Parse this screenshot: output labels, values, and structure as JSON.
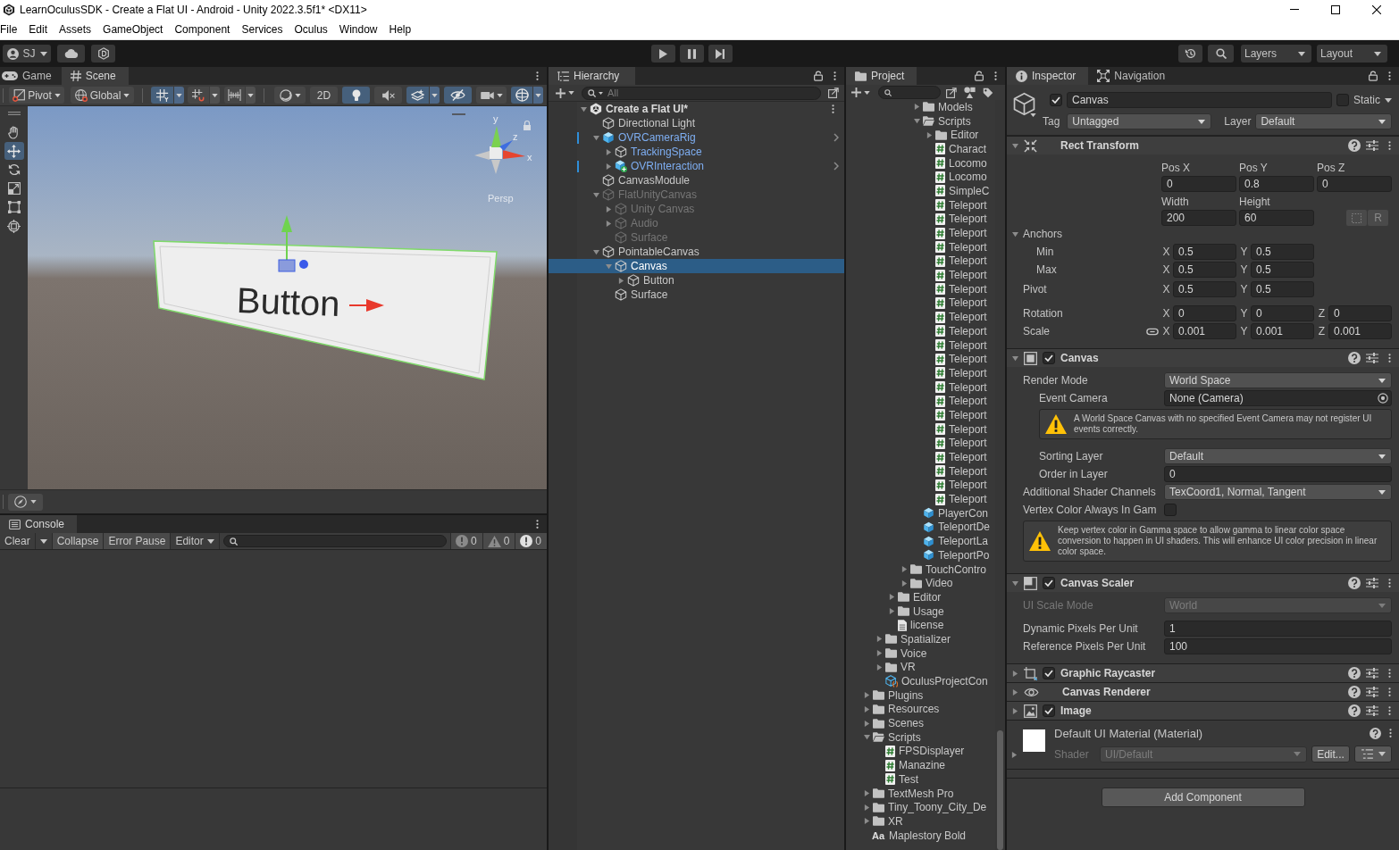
{
  "window": {
    "title": "LearnOculusSDK - Create a Flat UI - Android - Unity 2022.3.5f1* <DX11>"
  },
  "menu": [
    "File",
    "Edit",
    "Assets",
    "GameObject",
    "Component",
    "Services",
    "Oculus",
    "Window",
    "Help"
  ],
  "toolbar": {
    "account": "SJ",
    "layers": "Layers",
    "layout": "Layout"
  },
  "scene": {
    "tabs": [
      {
        "label": "Game",
        "kind": "game",
        "selected": false
      },
      {
        "label": "Scene",
        "kind": "scene",
        "selected": true
      }
    ],
    "toolbar": [
      {
        "kind": "pivot",
        "label": "Pivot",
        "on": false
      },
      {
        "kind": "global",
        "label": "Global",
        "on": false
      },
      {
        "kind": "grid",
        "on": true
      },
      {
        "kind": "snap",
        "on": false
      },
      {
        "kind": "increment",
        "on": false
      },
      {
        "kind": "shading",
        "on": false
      },
      {
        "kind": "flat",
        "label": "2D",
        "on": false
      },
      {
        "kind": "light",
        "on": true
      },
      {
        "kind": "audio",
        "on": false
      },
      {
        "kind": "fx",
        "on": true
      },
      {
        "kind": "visibility",
        "on": true
      },
      {
        "kind": "camera",
        "on": false
      },
      {
        "kind": "gizmos",
        "on": true
      }
    ],
    "tools": [
      {
        "kind": "view",
        "selected": false
      },
      {
        "kind": "move",
        "selected": true
      },
      {
        "kind": "rotate",
        "selected": false
      },
      {
        "kind": "scale",
        "selected": false
      },
      {
        "kind": "rect",
        "selected": false
      },
      {
        "kind": "transform",
        "selected": false
      }
    ],
    "viewport": {
      "canvas_text": "Button",
      "axis_labels": [
        "y",
        "x",
        "z"
      ],
      "projection": "Persp"
    }
  },
  "console": {
    "tab": "Console",
    "clear": "Clear",
    "collapse": {
      "label": "Collapse",
      "on": false
    },
    "error_pause": {
      "label": "Error Pause",
      "on": false
    },
    "target": "Editor",
    "counts": [
      {
        "kind": "log",
        "count": "0"
      },
      {
        "kind": "warning",
        "count": "0"
      },
      {
        "kind": "error",
        "count": "0"
      }
    ]
  },
  "hierarchy": {
    "tab": "Hierarchy",
    "search": {
      "placeholder": "All"
    },
    "tree": [
      {
        "label": "Create a Flat UI*",
        "kind": "scene",
        "expanded": true,
        "selected": false,
        "inactive": false,
        "children": [
          {
            "label": "Directional Light",
            "kind": "object",
            "selected": false,
            "inactive": false
          },
          {
            "label": "OVRCameraRig",
            "kind": "prefab-root",
            "expanded": true,
            "selected": false,
            "inactive": false,
            "children": [
              {
                "label": "TrackingSpace",
                "kind": "prefab-child",
                "expanded": false,
                "selected": false,
                "inactive": false
              },
              {
                "label": "OVRInteraction",
                "kind": "prefab-root-added",
                "expanded": false,
                "selected": false,
                "inactive": false
              }
            ]
          },
          {
            "label": "CanvasModule",
            "kind": "object",
            "selected": false,
            "inactive": false
          },
          {
            "label": "FlatUnityCanvas",
            "kind": "object",
            "expanded": true,
            "selected": false,
            "inactive": true,
            "children": [
              {
                "label": "Unity Canvas",
                "kind": "object",
                "expanded": false,
                "selected": false,
                "inactive": true
              },
              {
                "label": "Audio",
                "kind": "object",
                "expanded": false,
                "selected": false,
                "inactive": true
              },
              {
                "label": "Surface",
                "kind": "object",
                "selected": false,
                "inactive": true
              }
            ]
          },
          {
            "label": "PointableCanvas",
            "kind": "object",
            "expanded": true,
            "selected": false,
            "inactive": false,
            "children": [
              {
                "label": "Canvas",
                "kind": "object",
                "expanded": true,
                "selected": true,
                "inactive": false,
                "children": [
                  {
                    "label": "Button",
                    "kind": "object",
                    "expanded": false,
                    "selected": false,
                    "inactive": false
                  }
                ]
              },
              {
                "label": "Surface",
                "kind": "object",
                "selected": false,
                "inactive": false
              }
            ]
          }
        ]
      }
    ]
  },
  "project": {
    "tab": "Project",
    "tree": [
      {
        "children": [
          {
            "children": [
              {
                "children": [
                  {
                    "children": [
                      {
                        "label": "Models",
                        "kind": "folder",
                        "expanded": false,
                        "selected": false
                      },
                      {
                        "label": "Scripts",
                        "kind": "folder",
                        "expanded": true,
                        "selected": false,
                        "children": [
                          {
                            "label": "Editor",
                            "kind": "folder",
                            "expanded": false,
                            "selected": false
                          },
                          {
                            "label": "Charact",
                            "kind": "script",
                            "selected": false
                          },
                          {
                            "label": "Locomo",
                            "kind": "script",
                            "selected": false
                          },
                          {
                            "label": "Locomo",
                            "kind": "script",
                            "selected": false
                          },
                          {
                            "label": "SimpleC",
                            "kind": "script",
                            "selected": false
                          },
                          {
                            "label": "Teleport",
                            "kind": "script",
                            "selected": false
                          },
                          {
                            "label": "Teleport",
                            "kind": "script",
                            "selected": false
                          },
                          {
                            "label": "Teleport",
                            "kind": "script",
                            "selected": false
                          },
                          {
                            "label": "Teleport",
                            "kind": "script",
                            "selected": false
                          },
                          {
                            "label": "Teleport",
                            "kind": "script",
                            "selected": false
                          },
                          {
                            "label": "Teleport",
                            "kind": "script",
                            "selected": false
                          },
                          {
                            "label": "Teleport",
                            "kind": "script",
                            "selected": false
                          },
                          {
                            "label": "Teleport",
                            "kind": "script",
                            "selected": false
                          },
                          {
                            "label": "Teleport",
                            "kind": "script",
                            "selected": false
                          },
                          {
                            "label": "Teleport",
                            "kind": "script",
                            "selected": false
                          },
                          {
                            "label": "Teleport",
                            "kind": "script",
                            "selected": false
                          },
                          {
                            "label": "Teleport",
                            "kind": "script",
                            "selected": false
                          },
                          {
                            "label": "Teleport",
                            "kind": "script",
                            "selected": false
                          },
                          {
                            "label": "Teleport",
                            "kind": "script",
                            "selected": false
                          },
                          {
                            "label": "Teleport",
                            "kind": "script",
                            "selected": false
                          },
                          {
                            "label": "Teleport",
                            "kind": "script",
                            "selected": false
                          },
                          {
                            "label": "Teleport",
                            "kind": "script",
                            "selected": false
                          },
                          {
                            "label": "Teleport",
                            "kind": "script",
                            "selected": false
                          },
                          {
                            "label": "Teleport",
                            "kind": "script",
                            "selected": false
                          },
                          {
                            "label": "Teleport",
                            "kind": "script",
                            "selected": false
                          },
                          {
                            "label": "Teleport",
                            "kind": "script",
                            "selected": false
                          },
                          {
                            "label": "Teleport",
                            "kind": "script",
                            "selected": false
                          }
                        ]
                      },
                      {
                        "label": "PlayerCon",
                        "kind": "prefab",
                        "selected": false
                      },
                      {
                        "label": "TeleportDe",
                        "kind": "prefab",
                        "selected": false
                      },
                      {
                        "label": "TeleportLa",
                        "kind": "prefab",
                        "selected": false
                      },
                      {
                        "label": "TeleportPo",
                        "kind": "prefab",
                        "selected": false
                      }
                    ]
                  },
                  {
                    "label": "TouchContro",
                    "kind": "folder",
                    "expanded": false,
                    "selected": false
                  },
                  {
                    "label": "Video",
                    "kind": "folder",
                    "expanded": false,
                    "selected": false
                  }
                ]
              },
              {
                "label": "Editor",
                "kind": "folder",
                "expanded": false,
                "selected": false
              },
              {
                "label": "Usage",
                "kind": "folder",
                "expanded": false,
                "selected": false
              },
              {
                "label": "license",
                "kind": "file",
                "selected": false
              }
            ]
          },
          {
            "label": "Spatializer",
            "kind": "folder",
            "expanded": false,
            "selected": false
          },
          {
            "label": "Voice",
            "kind": "folder",
            "expanded": false,
            "selected": false
          },
          {
            "label": "VR",
            "kind": "folder",
            "expanded": false,
            "selected": false
          },
          {
            "label": "OculusProjectCon",
            "kind": "config",
            "selected": false
          }
        ]
      },
      {
        "label": "Plugins",
        "kind": "folder",
        "expanded": false,
        "selected": false
      },
      {
        "label": "Resources",
        "kind": "folder",
        "expanded": false,
        "selected": false
      },
      {
        "label": "Scenes",
        "kind": "folder",
        "expanded": false,
        "selected": false
      },
      {
        "label": "Scripts",
        "kind": "folder",
        "expanded": true,
        "selected": false,
        "children": [
          {
            "label": "FPSDisplayer",
            "kind": "script",
            "selected": false
          },
          {
            "label": "Manazine",
            "kind": "script",
            "selected": false
          },
          {
            "label": "Test",
            "kind": "script",
            "selected": false
          }
        ]
      },
      {
        "label": "TextMesh Pro",
        "kind": "folder",
        "expanded": false,
        "selected": false
      },
      {
        "label": "Tiny_Toony_City_De",
        "kind": "folder",
        "expanded": false,
        "selected": false
      },
      {
        "label": "XR",
        "kind": "folder",
        "expanded": false,
        "selected": false
      },
      {
        "label": "Maplestory Bold",
        "kind": "font",
        "glyph": "Aa",
        "selected": false
      }
    ]
  },
  "inspector": {
    "tabs": [
      {
        "label": "Inspector",
        "kind": "inspector",
        "selected": true
      },
      {
        "label": "Navigation",
        "kind": "navigation",
        "selected": false
      }
    ],
    "object": {
      "active": true,
      "name": "Canvas",
      "static": false,
      "static_label": "Static",
      "tag_label": "Tag",
      "tag": "Untagged",
      "layer_label": "Layer",
      "layer": "Default"
    },
    "components": [
      {
        "kind": "rect-transform",
        "title": "Rect Transform",
        "expanded": true,
        "position": [
          {
            "label": "Pos X",
            "value": "0"
          },
          {
            "label": "Pos Y",
            "value": "0.8"
          },
          {
            "label": "Pos Z",
            "value": "0"
          }
        ],
        "size": [
          {
            "label": "Width",
            "value": "200"
          },
          {
            "label": "Height",
            "value": "60"
          }
        ],
        "raw_button": "R",
        "anchors": {
          "label": "Anchors",
          "expanded": true,
          "rows": [
            {
              "label": "Min",
              "values": [
                {
                  "axis": "X",
                  "value": "0.5"
                },
                {
                  "axis": "Y",
                  "value": "0.5"
                }
              ]
            },
            {
              "label": "Max",
              "values": [
                {
                  "axis": "X",
                  "value": "0.5"
                },
                {
                  "axis": "Y",
                  "value": "0.5"
                }
              ]
            }
          ]
        },
        "pivot": {
          "label": "Pivot",
          "values": [
            {
              "axis": "X",
              "value": "0.5"
            },
            {
              "axis": "Y",
              "value": "0.5"
            }
          ]
        },
        "rotation": {
          "label": "Rotation",
          "values": [
            {
              "axis": "X",
              "value": "0"
            },
            {
              "axis": "Y",
              "value": "0"
            },
            {
              "axis": "Z",
              "value": "0"
            }
          ]
        },
        "scale": {
          "label": "Scale",
          "values": [
            {
              "axis": "X",
              "value": "0.001"
            },
            {
              "axis": "Y",
              "value": "0.001"
            },
            {
              "axis": "Z",
              "value": "0.001"
            }
          ]
        }
      },
      {
        "kind": "canvas",
        "title": "Canvas",
        "enabled": true,
        "expanded": true,
        "properties": [
          {
            "kind": "dropdown",
            "label": "Render Mode",
            "value": "World Space",
            "disabled": false,
            "children": [
              {
                "kind": "object",
                "label": "Event Camera",
                "value": "None (Camera)",
                "disabled": false
              },
              {
                "kind": "help",
                "text": "A World Space Canvas with no specified Event Camera may not register UI events correctly."
              },
              {
                "kind": "dropdown",
                "label": "Sorting Layer",
                "value": "Default",
                "disabled": false
              },
              {
                "kind": "number",
                "label": "Order in Layer",
                "value": "0",
                "disabled": false
              }
            ]
          },
          {
            "kind": "dropdown",
            "label": "Additional Shader Channels",
            "value": "TexCoord1, Normal, Tangent",
            "disabled": false
          },
          {
            "kind": "checkbox",
            "label": "Vertex Color Always In Gam",
            "checked": false,
            "disabled": false
          },
          {
            "kind": "help",
            "text": "Keep vertex color in Gamma space to allow gamma to linear color space conversion to happen in UI shaders. This will enhance UI color precision in linear color space."
          }
        ]
      },
      {
        "kind": "canvas-scaler",
        "title": "Canvas Scaler",
        "enabled": true,
        "expanded": true,
        "properties": [
          {
            "kind": "dropdown",
            "label": "UI Scale Mode",
            "value": "World",
            "disabled": true
          },
          {
            "kind": "number",
            "label": "Dynamic Pixels Per Unit",
            "value": "1",
            "disabled": false
          },
          {
            "kind": "number",
            "label": "Reference Pixels Per Unit",
            "value": "100",
            "disabled": false
          }
        ]
      },
      {
        "kind": "graphic-raycaster",
        "title": "Graphic Raycaster",
        "enabled": true,
        "expanded": false
      },
      {
        "kind": "canvas-renderer",
        "title": "Canvas Renderer",
        "expanded": false
      },
      {
        "kind": "image",
        "title": "Image",
        "enabled": true,
        "expanded": false
      }
    ],
    "material": {
      "name": "Default UI Material (Material)",
      "expanded": false,
      "shader_label": "Shader",
      "shader": "UI/Default",
      "edit": "Edit..."
    },
    "add_component": "Add Component"
  }
}
